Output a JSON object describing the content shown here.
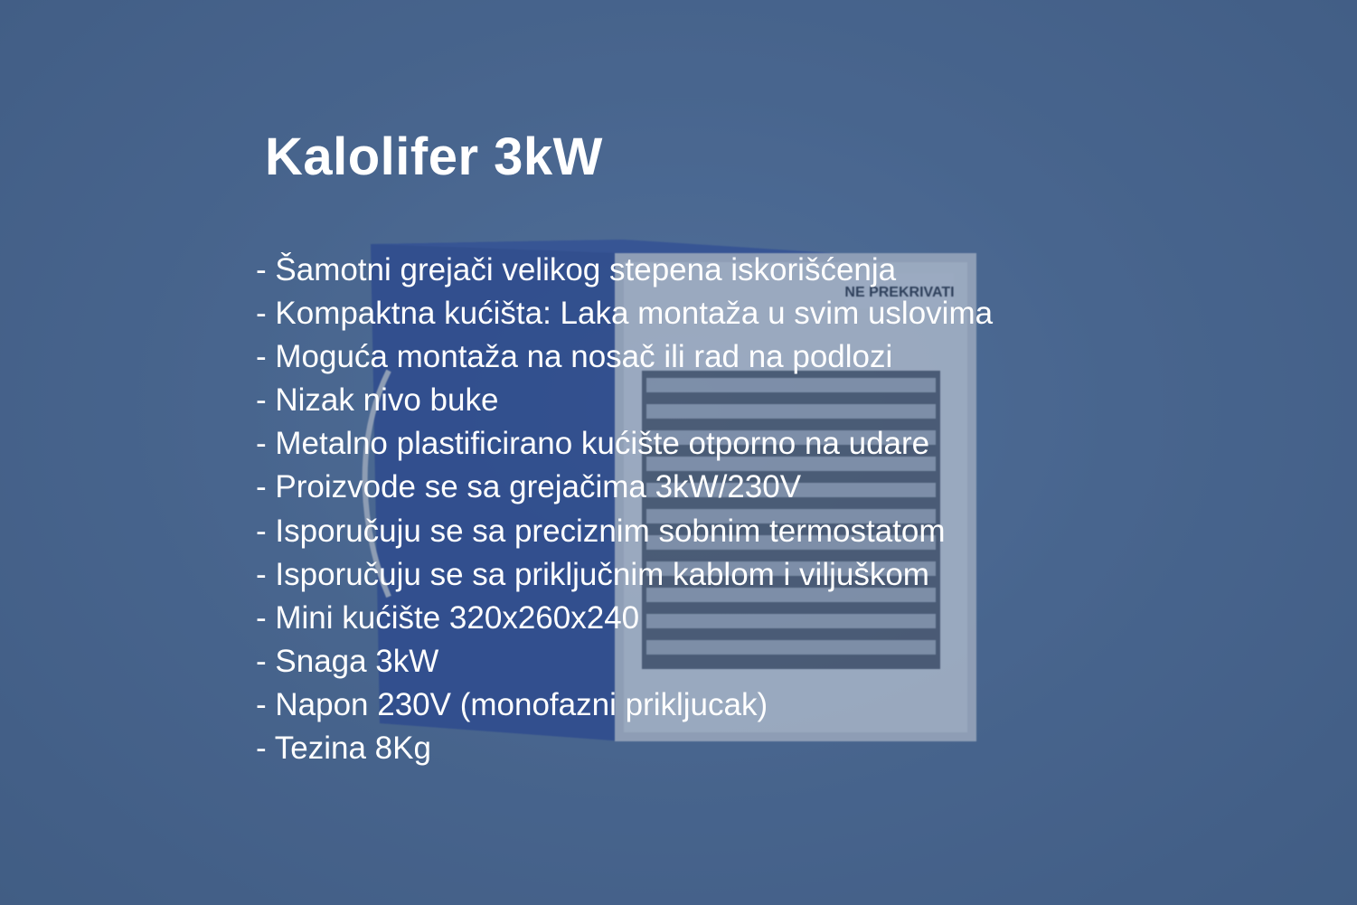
{
  "title": "Kalolifer 3kW",
  "features": [
    "- Šamotni grejači velikog stepena iskorišćenja",
    "- Kompaktna kućišta: Laka montaža u svim uslovima",
    "- Moguća montaža na nosač ili rad na podlozi",
    "- Nizak nivo buke",
    "- Metalno plastificirano kućište otporno na udare",
    "- Proizvode se sa grejačima 3kW/230V",
    "- Isporučuju se sa preciznim sobnim termostatom",
    "- Isporučuju se sa priključnim kablom i viljuškom",
    "- Mini kućište 320x260x240",
    "- Snaga 3kW",
    "- Napon 230V (monofazni prikljucak)",
    "- Tezina 8Kg"
  ],
  "background_product": {
    "label_text": "NE PREKRIVATI",
    "colors": {
      "background": "#4c6a90",
      "housing": "#1f3b8a",
      "grille": "#9aa4b3",
      "text": "#ffffff"
    }
  }
}
